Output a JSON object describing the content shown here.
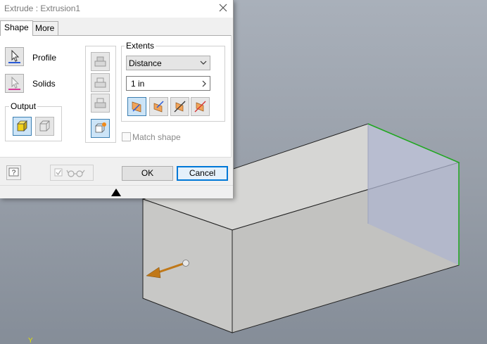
{
  "dialog": {
    "title": "Extrude : Extrusion1",
    "tabs": [
      {
        "label": "Shape"
      },
      {
        "label": "More"
      }
    ],
    "profile_label": "Profile",
    "solids_label": "Solids",
    "output_legend": "Output",
    "extents_legend": "Extents",
    "extents_type": "Distance",
    "distance_value": "1 in",
    "match_shape_label": "Match shape",
    "ok_label": "OK",
    "cancel_label": "Cancel"
  },
  "colors": {
    "accent": "#0078d7",
    "selected_edge": "#1fa81f",
    "arrow": "#c07818"
  }
}
